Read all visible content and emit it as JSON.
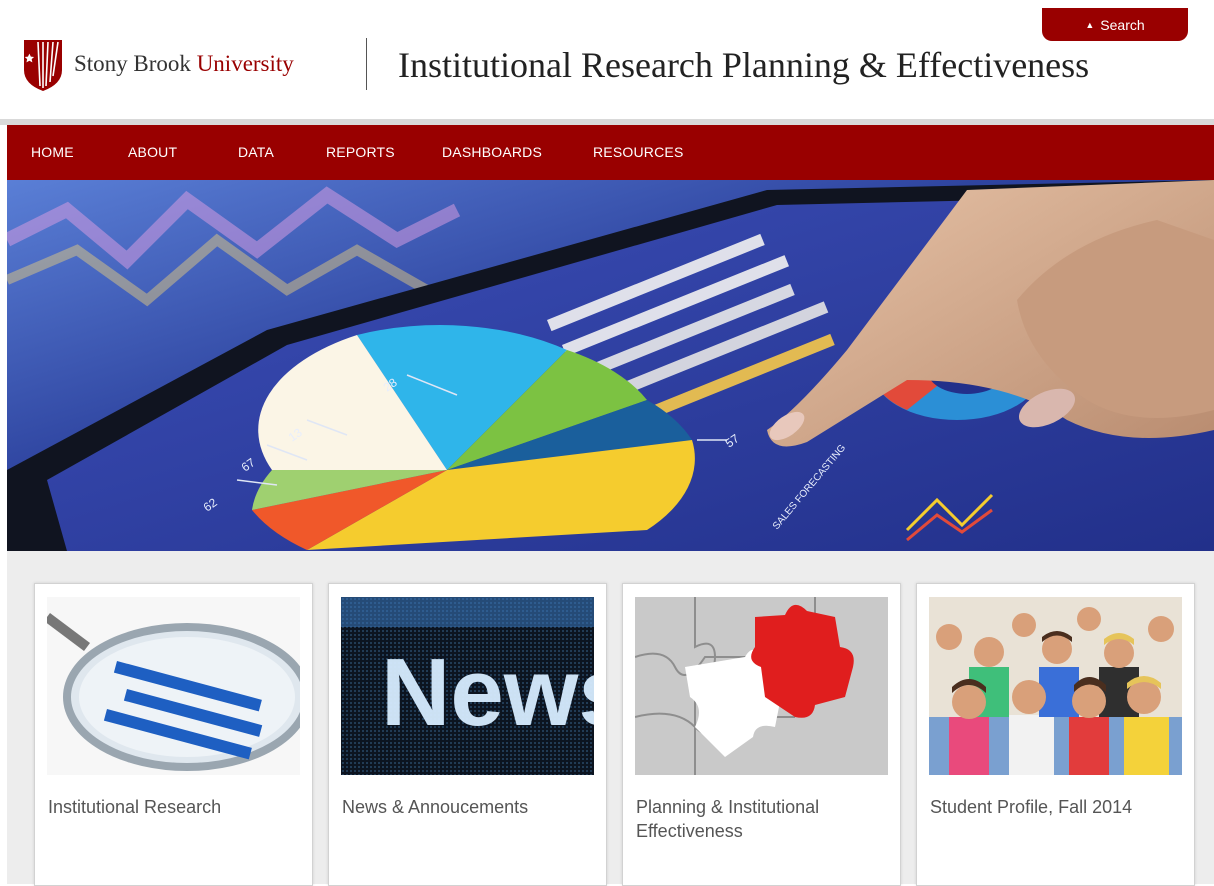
{
  "header": {
    "search_label": "Search",
    "logo": {
      "name_part": "Stony Brook ",
      "university_part": "University"
    },
    "site_title": "Institutional Research Planning & Effectiveness"
  },
  "nav": {
    "items": [
      {
        "label": "HOME"
      },
      {
        "label": "ABOUT"
      },
      {
        "label": "DATA"
      },
      {
        "label": "REPORTS"
      },
      {
        "label": "DASHBOARDS"
      },
      {
        "label": "RESOURCES"
      }
    ]
  },
  "hero": {
    "chart_labels": [
      "62",
      "67",
      "13",
      "28",
      "57"
    ],
    "screen_text": "SALES FORECASTING"
  },
  "tiles": [
    {
      "label": "Institutional Research",
      "image": "magnifier-bar-chart"
    },
    {
      "label": "News & Annoucements",
      "image": "led-news-sign",
      "image_text": "News"
    },
    {
      "label": "Planning & Institutional Effectiveness",
      "image": "red-puzzle-piece"
    },
    {
      "label": "Student Profile, Fall 2014",
      "image": "student-group-photo"
    }
  ],
  "colors": {
    "brand_red": "#990000",
    "tile_bg": "#ededed",
    "label_text": "#555555"
  }
}
